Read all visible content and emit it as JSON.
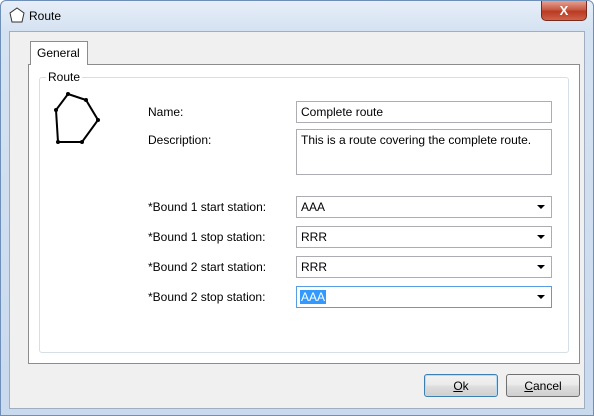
{
  "window": {
    "title": "Route",
    "close_label": "X"
  },
  "tabs": [
    {
      "label": "General"
    }
  ],
  "group": {
    "legend": "Route"
  },
  "form": {
    "name_label": "Name:",
    "name_value": "Complete route",
    "description_label": "Description:",
    "description_value": "This is a route covering the complete route.",
    "bound1_start_label": "*Bound 1 start station:",
    "bound1_start_value": "AAA",
    "bound1_stop_label": "*Bound 1 stop station:",
    "bound1_stop_value": "RRR",
    "bound2_start_label": "*Bound 2 start station:",
    "bound2_start_value": "RRR",
    "bound2_stop_label": "*Bound 2 stop station:",
    "bound2_stop_value": "AAA"
  },
  "buttons": {
    "ok_mnemonic": "O",
    "ok_rest": "k",
    "cancel_mnemonic": "C",
    "cancel_rest": "ancel"
  },
  "icons": {
    "title": "pentagon-outline-icon",
    "route": "route-polygon-icon",
    "dropdown": "chevron-down-icon"
  },
  "colors": {
    "selection": "#3399ff",
    "close_button": "#c75b45"
  }
}
